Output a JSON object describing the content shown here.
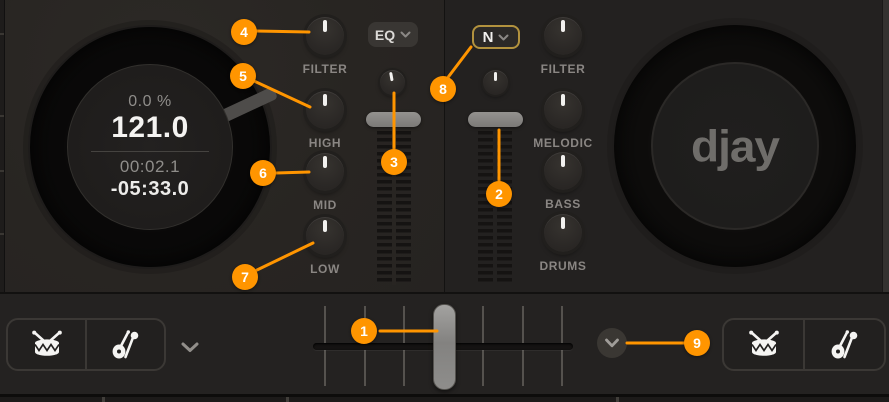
{
  "left_deck": {
    "display": {
      "tempo": "0.0 %",
      "bpm": "121.0",
      "elapsed": "00:02.1",
      "remaining": "-05:33.0"
    },
    "eq_button": {
      "label": "EQ"
    },
    "knobs": [
      {
        "label": "FILTER"
      },
      {
        "label": "HIGH"
      },
      {
        "label": "MID"
      },
      {
        "label": "LOW"
      }
    ]
  },
  "right_deck": {
    "mode_button": {
      "label": "N"
    },
    "knobs": [
      {
        "label": "FILTER"
      },
      {
        "label": "MELODIC"
      },
      {
        "label": "BASS"
      },
      {
        "label": "DRUMS"
      }
    ],
    "platter_logo": "djay"
  },
  "mixer": {
    "icons": {
      "library_toggle_buttons": [
        "drum-icon",
        "instruments-icon"
      ],
      "expand_buttons": [
        "chevron-down-icon",
        "chevron-down-icon"
      ],
      "dropdown_chevrons": [
        "chevron-down-icon",
        "chevron-down-icon"
      ]
    }
  },
  "callouts": [
    {
      "label": "1"
    },
    {
      "label": "2"
    },
    {
      "label": "3"
    },
    {
      "label": "4"
    },
    {
      "label": "5"
    },
    {
      "label": "6"
    },
    {
      "label": "7"
    },
    {
      "label": "8"
    },
    {
      "label": "9"
    }
  ],
  "colors": {
    "accent": "#FF9500",
    "mode_button_border": "#B2923E"
  }
}
